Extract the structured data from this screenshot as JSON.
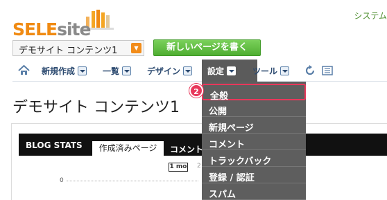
{
  "header": {
    "logo_sele": "SELE",
    "logo_site": "site",
    "top_right_text": "システム"
  },
  "site_selector": {
    "value": "デモサイト コンテンツ1"
  },
  "new_page_button": "新しいページを書く",
  "nav": {
    "items": [
      {
        "label": "新規作成"
      },
      {
        "label": "一覧"
      },
      {
        "label": "デザイン"
      },
      {
        "label": "設定"
      },
      {
        "label": "ツール"
      }
    ],
    "active": "設定"
  },
  "page_title": "デモサイト コンテンツ1",
  "blog_stats": {
    "title": "BLOG STATS",
    "tab_active": "作成済みページ",
    "tab_other": "コメント",
    "range_active": "1 mo",
    "range_next": "2",
    "axis_zero": "0"
  },
  "dropdown": {
    "items": [
      "全般",
      "公開",
      "新規ページ",
      "コメント",
      "トラックバック",
      "登録 / 認証",
      "スパム"
    ],
    "highlighted_index": 0
  },
  "step_badge": "2",
  "colors": {
    "accent_orange": "#f08a12",
    "nav_text": "#2c4a70",
    "menu_bg": "#5e5e5e",
    "highlight": "#e8375a",
    "green_button": "#4fae32"
  }
}
